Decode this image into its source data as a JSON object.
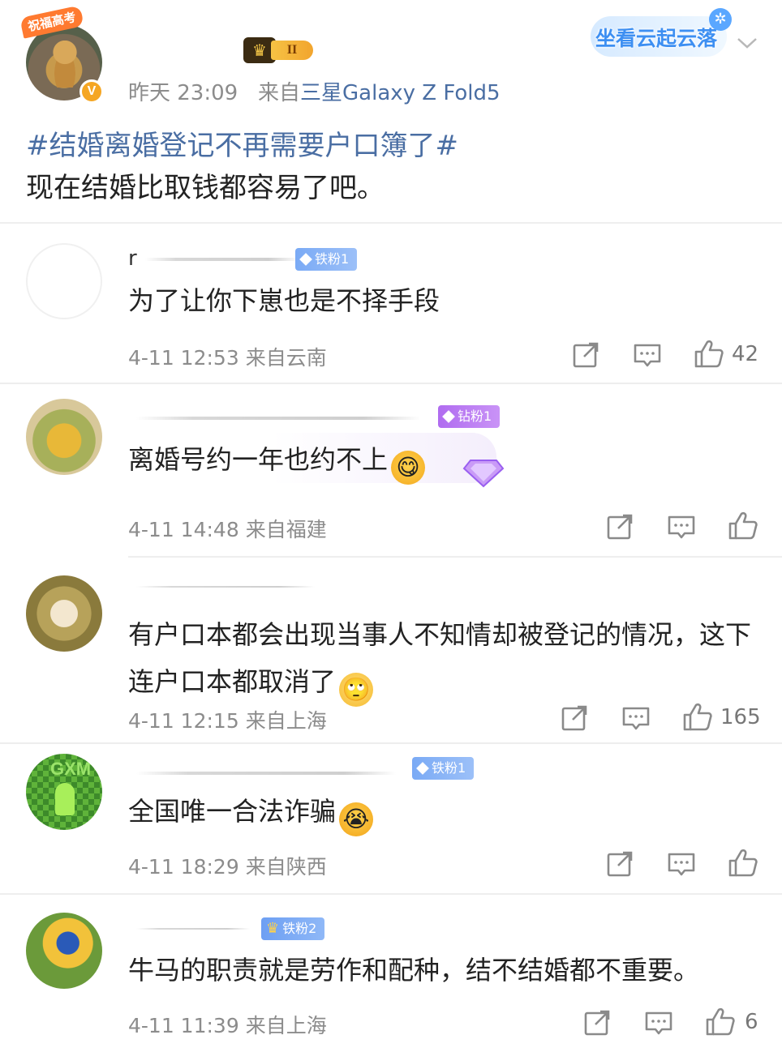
{
  "post": {
    "avatar_tag": "祝福高考",
    "verified_mark": "V",
    "level_badge": "II",
    "cloud_badge": "坐看云起云落",
    "time": "昨天 23:09",
    "source_prefix": "来自",
    "device": "三星Galaxy Z Fold5",
    "topic": "#结婚离婚登记不再需要户口簿了#",
    "text": "现在结婚比取钱都容易了吧。"
  },
  "comments": [
    {
      "name": "r",
      "badge": "铁粉1",
      "text": "为了让你下崽也是不择手段",
      "time": "4-11 12:53",
      "location": "来自云南",
      "likes": "42"
    },
    {
      "name": "",
      "badge": "钻粉1",
      "text": "离婚号约一年也约不上",
      "time": "4-11 14:48",
      "location": "来自福建",
      "likes": ""
    },
    {
      "name": "",
      "badge": "",
      "text": "有户口本都会出现当事人不知情却被登记的情况，这下连户口本都取消了",
      "time": "4-11 12:15",
      "location": "来自上海",
      "likes": "165"
    },
    {
      "name": "",
      "badge": "铁粉1",
      "avatar_text": "GXM",
      "text": "全国唯一合法诈骗",
      "time": "4-11 18:29",
      "location": "来自陕西",
      "likes": ""
    },
    {
      "name": "",
      "badge": "铁粉2",
      "text": "牛马的职责就是劳作和配种，结不结婚都不重要。",
      "time": "4-11 11:39",
      "location": "来自上海",
      "likes": "6"
    }
  ],
  "icons": {
    "share": "share-icon",
    "comment": "comment-icon",
    "like": "like-icon",
    "chevron": "chevron-down-icon"
  },
  "colors": {
    "link": "#4a6ea3",
    "meta": "#8c8c8c",
    "iron_badge": "#7aaaf5",
    "diamond_badge": "#b06cf0"
  }
}
